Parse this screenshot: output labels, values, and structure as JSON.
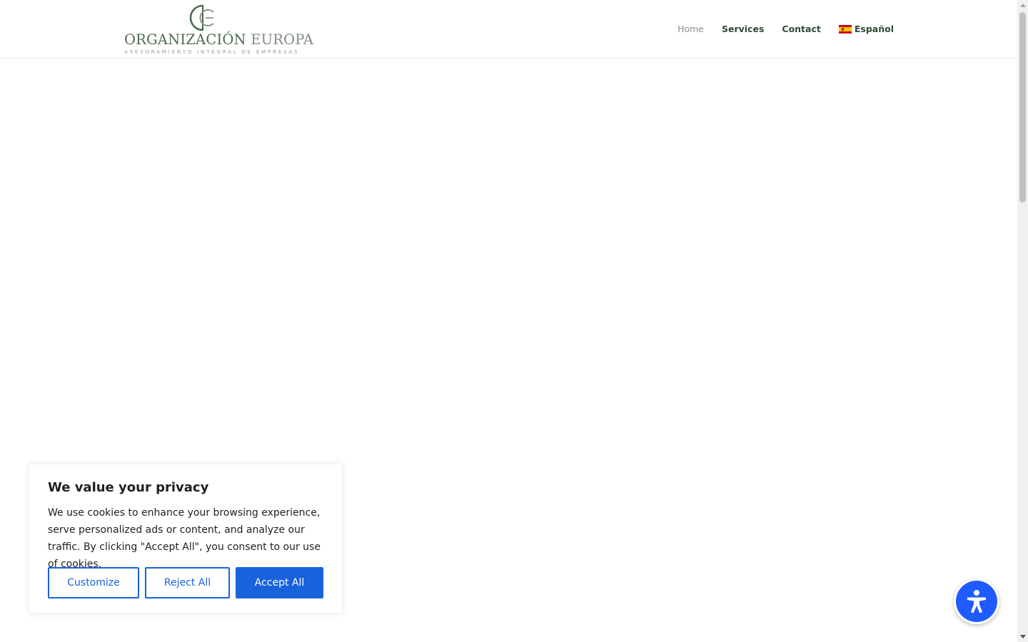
{
  "header": {
    "logo": {
      "name_main": "ORGANIZACIÓN",
      "name_secondary": "EUROPA",
      "tagline": "ASESORAMIENTO INTEGRAL DE EMPRESAS"
    },
    "nav": [
      {
        "label": "Home",
        "current": true
      },
      {
        "label": "Services",
        "current": false
      },
      {
        "label": "Contact",
        "current": false
      },
      {
        "label": "Español",
        "current": false,
        "icon": "spain-flag-icon"
      }
    ]
  },
  "cookie_banner": {
    "title": "We value your privacy",
    "text": "We use cookies to enhance your browsing experience, serve personalized ads or content, and analyze our traffic. By clicking \"Accept All\", you consent to our use of cookies.",
    "buttons": {
      "customize": "Customize",
      "reject": "Reject All",
      "accept": "Accept All"
    }
  },
  "accessibility": {
    "icon": "accessibility-person-icon"
  },
  "colors": {
    "brand_green": "#4c6b4f",
    "nav_text": "#2f4a36",
    "nav_current": "#8f8f8f",
    "cookie_accent": "#1863dc",
    "a11y_blue": "#1f5bff"
  }
}
